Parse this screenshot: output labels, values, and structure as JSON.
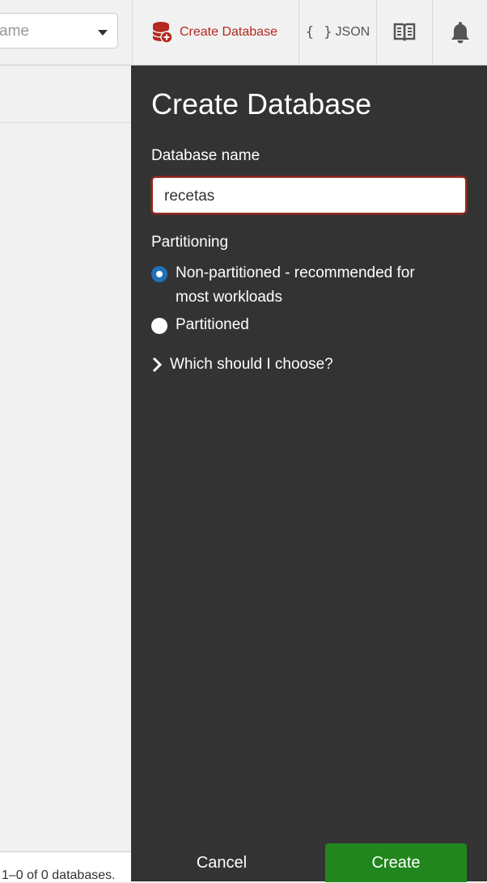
{
  "header": {
    "database_select_placeholder": "ame",
    "create_database_label": "Create Database",
    "json_braces": "{ }",
    "json_label": "JSON"
  },
  "left_pane": {
    "footer_text": "1–0 of 0 databases."
  },
  "tray": {
    "title": "Create Database",
    "database_name_label": "Database name",
    "database_name_value": "recetas",
    "partitioning_label": "Partitioning",
    "options": [
      {
        "label": "Non-partitioned - recommended for most workloads",
        "selected": true
      },
      {
        "label": "Partitioned",
        "selected": false
      }
    ],
    "help_link": "Which should I choose?",
    "cancel_label": "Cancel",
    "create_label": "Create"
  },
  "colors": {
    "accent_red": "#b4281e",
    "create_green": "#21861d",
    "radio_blue": "#1f71b8",
    "tray_background": "#333333"
  },
  "icons": [
    "caret-down-icon",
    "database-add-icon",
    "book-icon",
    "bell-icon",
    "chevron-right-icon"
  ]
}
